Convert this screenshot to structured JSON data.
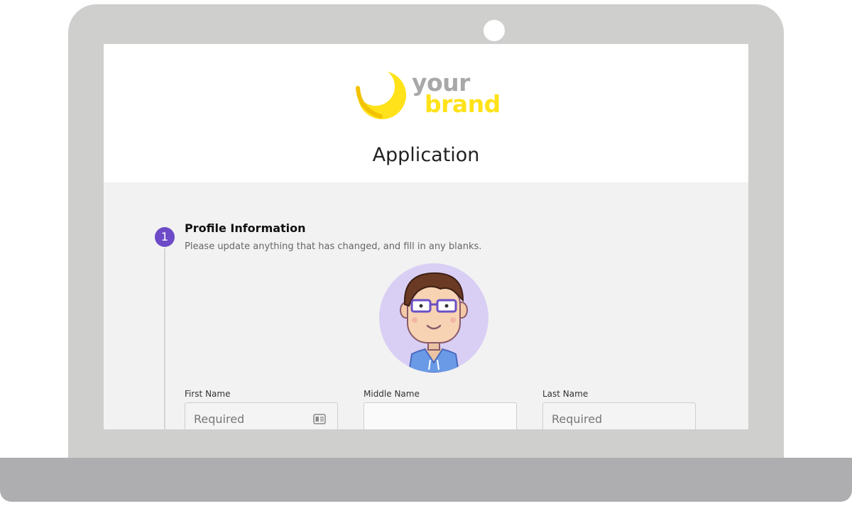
{
  "brand": {
    "word_1": "your",
    "word_2": "brand",
    "accent_color": "#ffe21a",
    "muted_color": "#a8a8a8"
  },
  "page": {
    "title": "Application"
  },
  "section": {
    "step_number": "1",
    "title": "Profile Information",
    "subtitle": "Please update anything that has changed, and fill in any blanks.",
    "step_color": "#6d4bc8"
  },
  "avatar": {
    "icon": "user-avatar-illustration"
  },
  "fields": {
    "first_name": {
      "label": "First Name",
      "value": "",
      "placeholder": "Required",
      "icon": "contact-card-icon"
    },
    "middle_name": {
      "label": "Middle Name",
      "value": "",
      "placeholder": ""
    },
    "last_name": {
      "label": "Last Name",
      "value": "",
      "placeholder": "Required"
    }
  }
}
